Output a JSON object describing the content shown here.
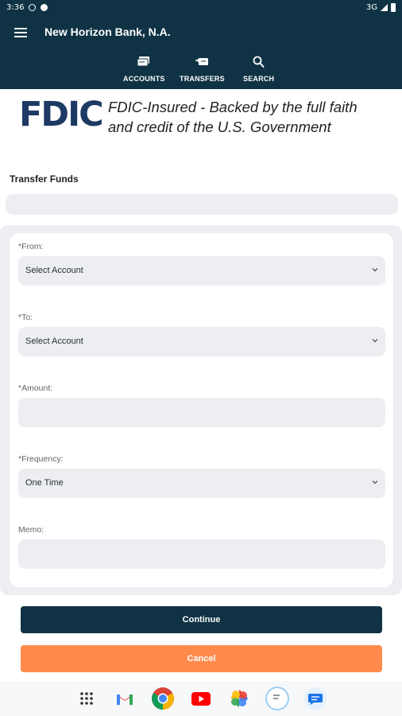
{
  "status_bar": {
    "time": "3:36",
    "network": "3G"
  },
  "header": {
    "title": "New Horizon Bank, N.A.",
    "nav": [
      {
        "label": "ACCOUNTS",
        "icon": "accounts-icon"
      },
      {
        "label": "TRANSFERS",
        "icon": "transfers-icon"
      },
      {
        "label": "SEARCH",
        "icon": "search-icon"
      }
    ]
  },
  "fdic": {
    "logo_text": "FDIC",
    "line1": "FDIC-Insured - Backed by the full faith",
    "line2": "and credit of the U.S. Government"
  },
  "page": {
    "heading": "Transfer Funds"
  },
  "form": {
    "from": {
      "label": "*From:",
      "value": "Select Account"
    },
    "to": {
      "label": "*To:",
      "value": "Select Account"
    },
    "amount": {
      "label": "*Amount:",
      "value": ""
    },
    "frequency": {
      "label": "*Frequency:",
      "value": "One Time"
    },
    "memo": {
      "label": "Memo:",
      "value": ""
    }
  },
  "buttons": {
    "continue": "Continue",
    "cancel": "Cancel"
  },
  "taskbar": {
    "apps": [
      "app-drawer-icon",
      "gmail-icon",
      "chrome-icon",
      "youtube-icon",
      "photos-icon",
      "messages-icon",
      "chat-icon"
    ]
  },
  "colors": {
    "header_bg": "#0f3344",
    "fdic_blue": "#1d3a64",
    "cancel_orange": "#ff8a4c",
    "field_bg": "#eceef2"
  }
}
